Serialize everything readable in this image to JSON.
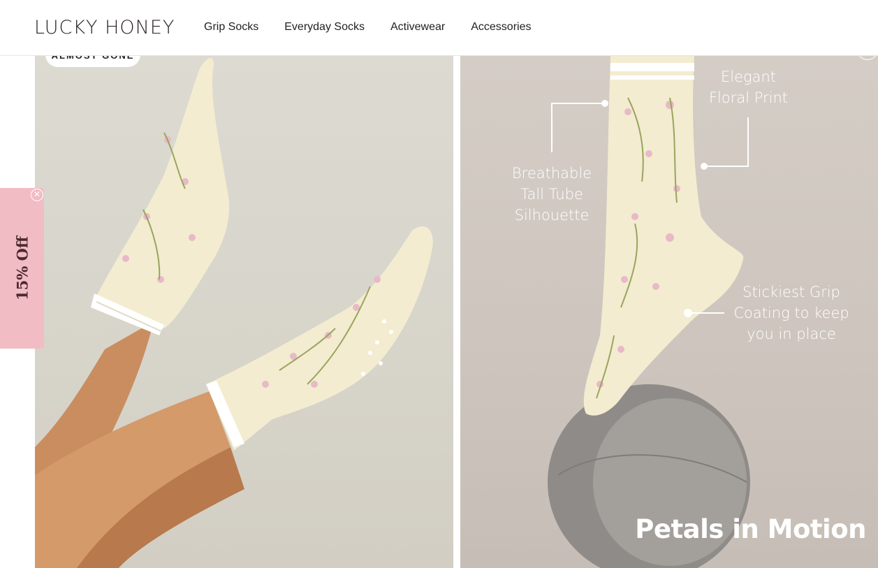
{
  "brand": {
    "logo": "LUCKY HONEY"
  },
  "nav": {
    "items": [
      {
        "label": "Grip Socks"
      },
      {
        "label": "Everyday Socks"
      },
      {
        "label": "Activewear"
      },
      {
        "label": "Accessories"
      }
    ]
  },
  "hero": {
    "left_badge": "ALMOST GONE",
    "annotations": {
      "floral": "Elegant Floral Print",
      "tube": "Breathable Tall Tube Silhouette",
      "grip": "Stickiest Grip Coating to keep you in place"
    },
    "headline": "Petals in Motion"
  },
  "discount": {
    "label": "15% Off",
    "close_icon": "close-circle-icon"
  },
  "colors": {
    "discount_bg": "#f2bcc4",
    "sock_cream": "#f3ecd0",
    "flower_pink": "#e8b9c7",
    "leaf_green": "#9aa45e"
  }
}
